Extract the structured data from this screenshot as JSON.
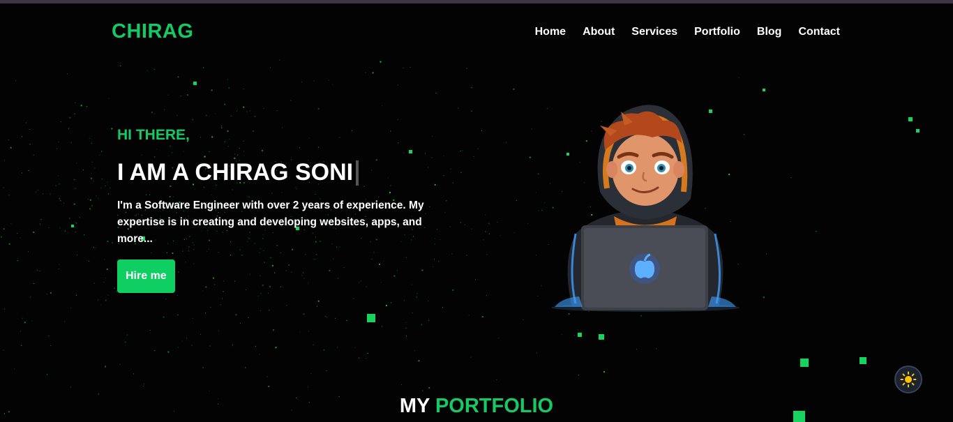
{
  "brand": {
    "logo": "CHIRAG"
  },
  "nav": {
    "items": [
      "Home",
      "About",
      "Services",
      "Portfolio",
      "Blog",
      "Contact"
    ]
  },
  "hero": {
    "greeting": "HI THERE,",
    "headline": "I AM A CHIRAG SONI",
    "description": "I'm a Software Engineer with over 2 years of experience. My expertise is in creating and developing websites, apps, and more...",
    "cta_label": "Hire me"
  },
  "portfolio": {
    "title_plain": "MY",
    "title_accent": "PORTFOLIO"
  },
  "theme": {
    "accent": "#17c964",
    "background": "#030303",
    "toggle_icon": "sun-icon"
  }
}
